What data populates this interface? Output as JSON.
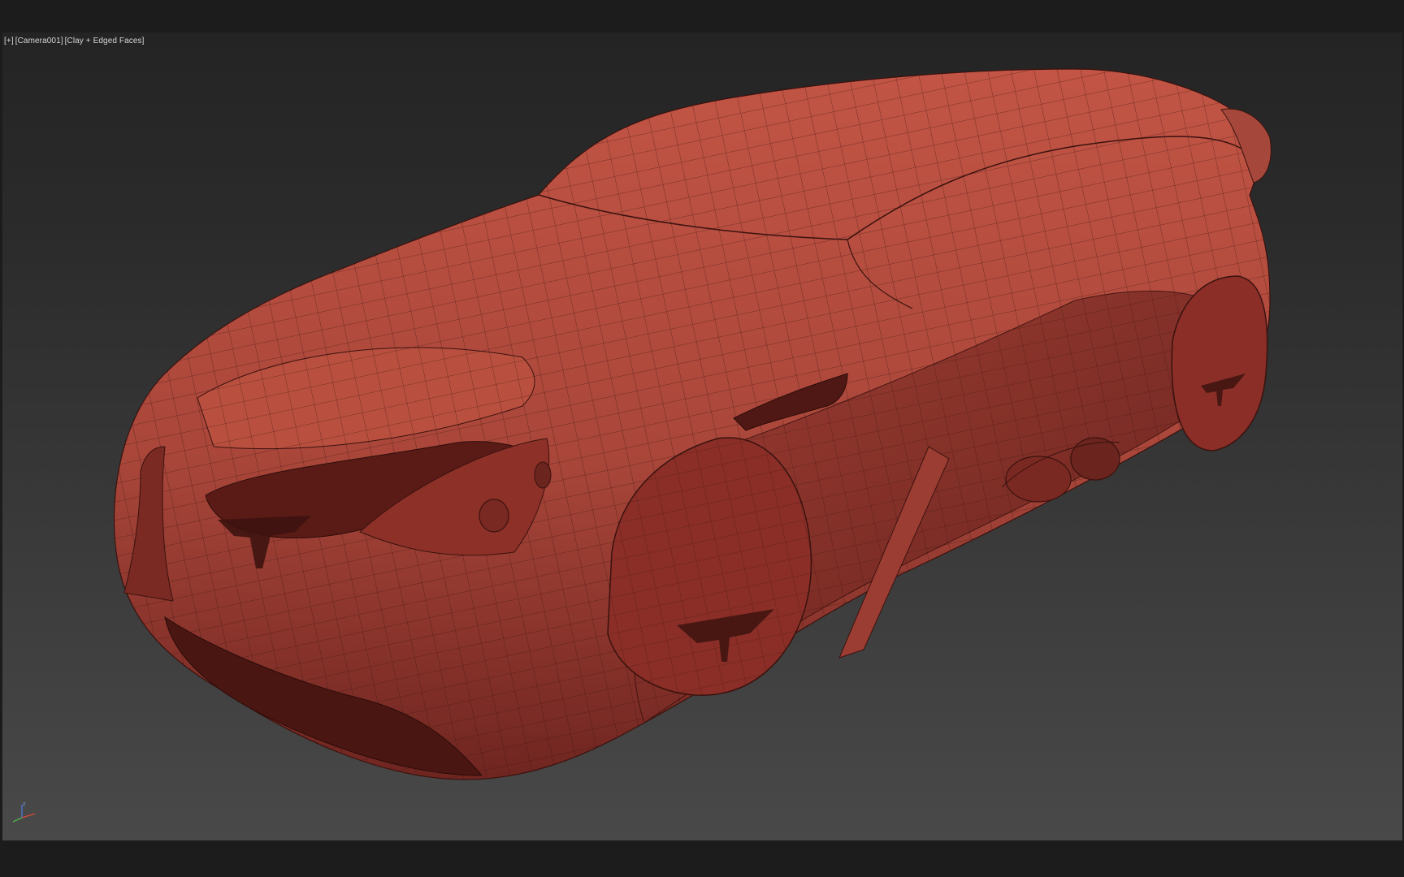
{
  "viewport": {
    "label_parts": [
      "[+]",
      "[Camera001]",
      "[Clay + Edged Faces]"
    ],
    "axis_label": "z"
  },
  "model": {
    "color": "#b24a3b",
    "shadow_color": "#7a2a22",
    "wire_color": "#3a120e"
  }
}
